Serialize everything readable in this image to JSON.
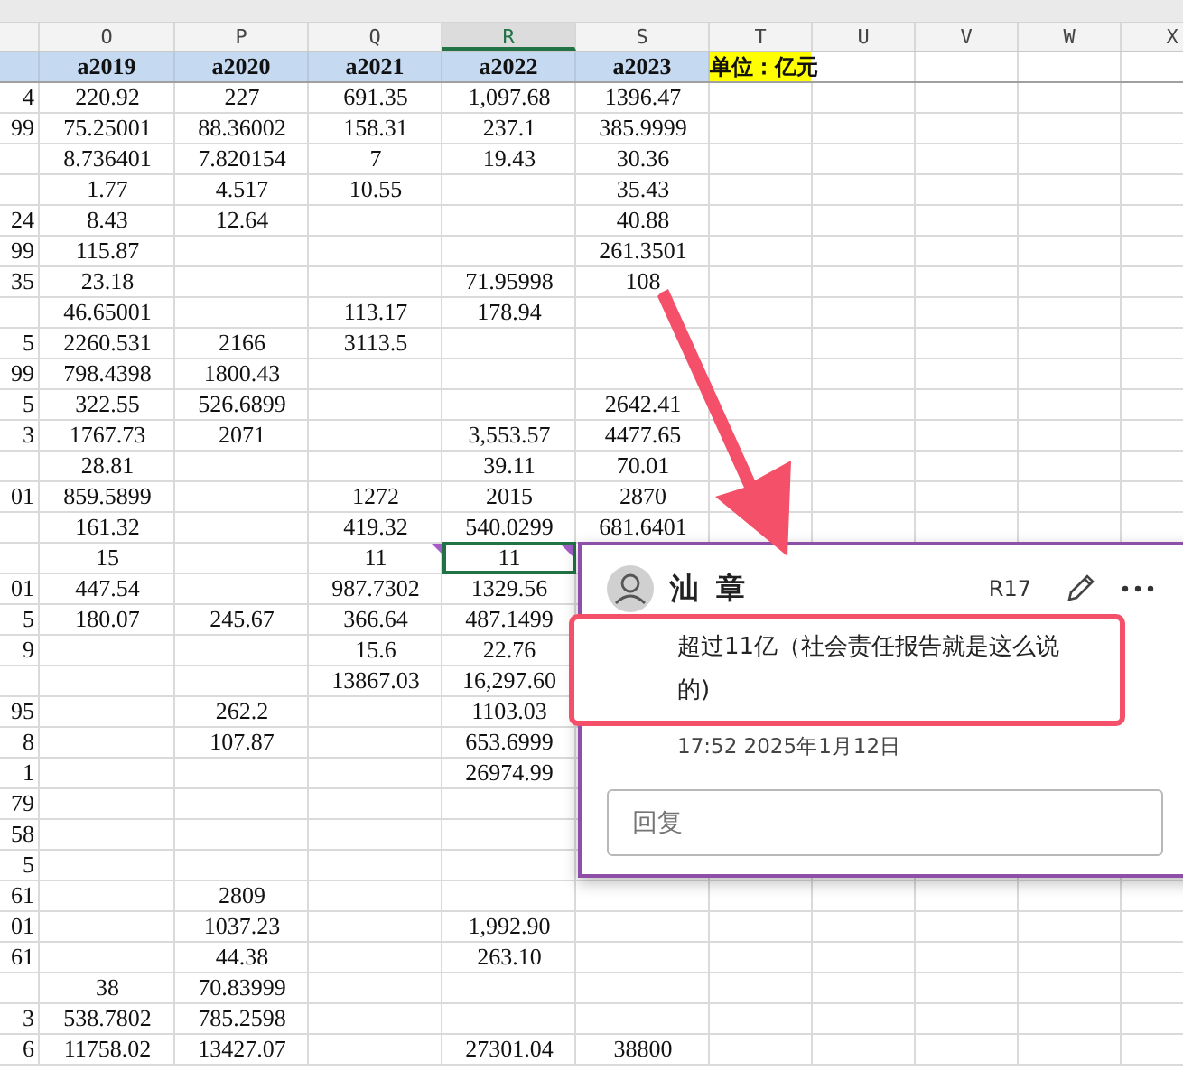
{
  "columns": [
    {
      "selected": false
    },
    {
      "letter": "O",
      "selected": false
    },
    {
      "letter": "P",
      "selected": false
    },
    {
      "letter": "Q",
      "selected": false
    },
    {
      "letter": "R",
      "selected": true
    },
    {
      "letter": "S",
      "selected": false
    },
    {
      "letter": "T",
      "selected": false
    },
    {
      "letter": "U",
      "selected": false
    },
    {
      "letter": "V",
      "selected": false
    },
    {
      "letter": "W",
      "selected": false
    },
    {
      "letter": "X",
      "selected": false
    }
  ],
  "field_headers": [
    "a2019",
    "a2020",
    "a2021",
    "a2022",
    "a2023"
  ],
  "unit_label": "单位：亿元",
  "rows": [
    {
      "cells": [
        "4",
        "220.92",
        "227",
        "691.35",
        "1,097.68",
        "1396.47"
      ],
      "selected": false,
      "comment_marks": false
    },
    {
      "cells": [
        "99",
        "75.25001",
        "88.36002",
        "158.31",
        "237.1",
        "385.9999"
      ],
      "selected": false,
      "comment_marks": false
    },
    {
      "cells": [
        null,
        "8.736401",
        "7.820154",
        "7",
        "19.43",
        "30.36"
      ],
      "selected": false,
      "comment_marks": false
    },
    {
      "cells": [
        null,
        "1.77",
        "4.517",
        "10.55",
        null,
        "35.43"
      ],
      "selected": false,
      "comment_marks": false
    },
    {
      "cells": [
        "24",
        "8.43",
        "12.64",
        null,
        null,
        "40.88"
      ],
      "selected": false,
      "comment_marks": false
    },
    {
      "cells": [
        "99",
        "115.87",
        null,
        null,
        null,
        "261.3501"
      ],
      "selected": false,
      "comment_marks": false
    },
    {
      "cells": [
        "35",
        "23.18",
        null,
        null,
        "71.95998",
        "108"
      ],
      "selected": false,
      "comment_marks": false
    },
    {
      "cells": [
        null,
        "46.65001",
        null,
        "113.17",
        "178.94",
        null
      ],
      "selected": false,
      "comment_marks": false
    },
    {
      "cells": [
        "5",
        "2260.531",
        "2166",
        "3113.5",
        null,
        null
      ],
      "selected": false,
      "comment_marks": false
    },
    {
      "cells": [
        "99",
        "798.4398",
        "1800.43",
        null,
        null,
        null
      ],
      "selected": false,
      "comment_marks": false
    },
    {
      "cells": [
        "5",
        "322.55",
        "526.6899",
        null,
        null,
        "2642.41"
      ],
      "selected": false,
      "comment_marks": false
    },
    {
      "cells": [
        "3",
        "1767.73",
        "2071",
        null,
        "3,553.57",
        "4477.65"
      ],
      "selected": false,
      "comment_marks": false
    },
    {
      "cells": [
        null,
        "28.81",
        null,
        null,
        "39.11",
        "70.01"
      ],
      "selected": false,
      "comment_marks": false
    },
    {
      "cells": [
        "01",
        "859.5899",
        null,
        "1272",
        "2015",
        "2870"
      ],
      "selected": false,
      "comment_marks": false
    },
    {
      "cells": [
        null,
        "161.32",
        null,
        "419.32",
        "540.0299",
        "681.6401"
      ],
      "selected": false,
      "comment_marks": false
    },
    {
      "cells": [
        null,
        "15",
        null,
        "11",
        "11",
        null
      ],
      "selected": true,
      "comment_marks": true
    },
    {
      "cells": [
        "01",
        "447.54",
        null,
        "987.7302",
        "1329.56",
        null
      ],
      "selected": false,
      "comment_marks": false
    },
    {
      "cells": [
        "5",
        "180.07",
        "245.67",
        "366.64",
        "487.1499",
        null
      ],
      "selected": false,
      "comment_marks": false
    },
    {
      "cells": [
        "9",
        null,
        null,
        "15.6",
        "22.76",
        null
      ],
      "selected": false,
      "comment_marks": false
    },
    {
      "cells": [
        null,
        null,
        null,
        "13867.03",
        "16,297.60",
        null
      ],
      "selected": false,
      "comment_marks": false
    },
    {
      "cells": [
        "95",
        null,
        "262.2",
        null,
        "1103.03",
        null
      ],
      "selected": false,
      "comment_marks": false
    },
    {
      "cells": [
        "8",
        null,
        "107.87",
        null,
        "653.6999",
        null
      ],
      "selected": false,
      "comment_marks": false
    },
    {
      "cells": [
        "1",
        null,
        null,
        null,
        "26974.99",
        null
      ],
      "selected": false,
      "comment_marks": false
    },
    {
      "cells": [
        "79",
        null,
        null,
        null,
        null,
        null
      ],
      "selected": false,
      "comment_marks": false
    },
    {
      "cells": [
        "58",
        null,
        null,
        null,
        null,
        null
      ],
      "selected": false,
      "comment_marks": false
    },
    {
      "cells": [
        "5",
        null,
        null,
        null,
        null,
        null
      ],
      "selected": false,
      "comment_marks": false
    },
    {
      "cells": [
        "61",
        null,
        "2809",
        null,
        null,
        null
      ],
      "selected": false,
      "comment_marks": false
    },
    {
      "cells": [
        "01",
        null,
        "1037.23",
        null,
        "1,992.90",
        null
      ],
      "selected": false,
      "comment_marks": false
    },
    {
      "cells": [
        "61",
        null,
        "44.38",
        null,
        "263.10",
        null
      ],
      "selected": false,
      "comment_marks": false
    },
    {
      "cells": [
        null,
        "38",
        "70.83999",
        null,
        null,
        null
      ],
      "selected": false,
      "comment_marks": false
    },
    {
      "cells": [
        "3",
        "538.7802",
        "785.2598",
        null,
        null,
        null
      ],
      "selected": false,
      "comment_marks": false
    },
    {
      "cells": [
        "6",
        "11758.02",
        "13427.07",
        null,
        "27301.04",
        "38800"
      ],
      "selected": false,
      "comment_marks": false
    }
  ],
  "comment": {
    "author": "汕 章",
    "cell_ref": "R17",
    "text": "超过11亿（社会责任报告就是这么说的)",
    "time": "17:52 2025年1月12日",
    "reply_placeholder": "回复"
  }
}
